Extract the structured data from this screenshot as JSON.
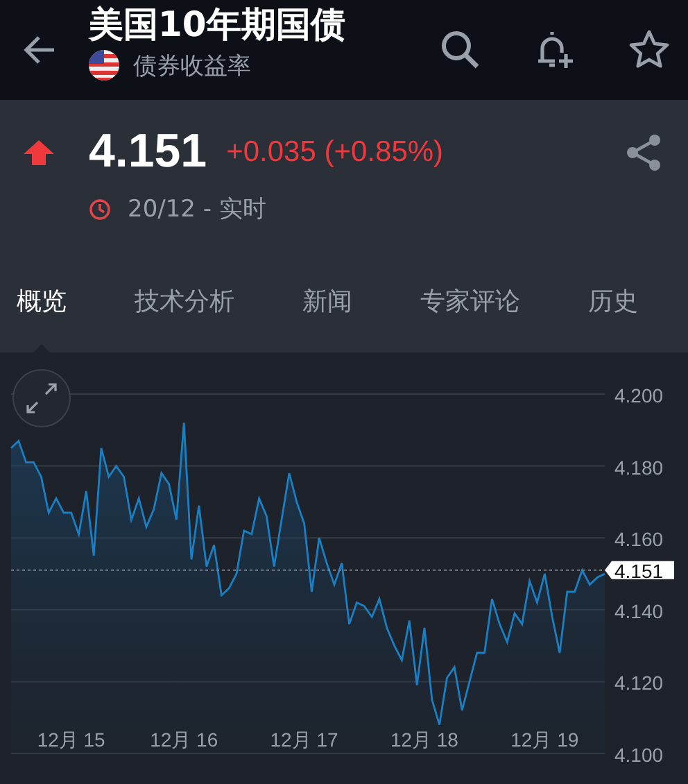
{
  "header": {
    "title": "美国10年期国债",
    "subtitle": "债券收益率"
  },
  "quote": {
    "rising": true,
    "price": "4.151",
    "change": "+0.035 (+0.85%)",
    "time": "20/12 - 实时"
  },
  "tabs": [
    {
      "label": "概览",
      "selected": true
    },
    {
      "label": "技术分析",
      "selected": false
    },
    {
      "label": "新闻",
      "selected": false
    },
    {
      "label": "专家评论",
      "selected": false
    },
    {
      "label": "历史",
      "selected": false
    }
  ],
  "chart": {
    "chart_data": {
      "type": "area",
      "categories": [
        null,
        null,
        null,
        null,
        null,
        null,
        null,
        null,
        "12月 15",
        null,
        null,
        null,
        null,
        null,
        null,
        null,
        null,
        null,
        null,
        null,
        null,
        null,
        null,
        "12月 16",
        null,
        null,
        null,
        null,
        null,
        null,
        null,
        null,
        null,
        null,
        null,
        null,
        null,
        null,
        null,
        "12月 17",
        null,
        null,
        null,
        null,
        null,
        null,
        null,
        null,
        null,
        null,
        null,
        null,
        null,
        null,
        null,
        "12月 18",
        null,
        null,
        null,
        null,
        null,
        null,
        null,
        null,
        null,
        null,
        null,
        null,
        null,
        null,
        null,
        "12月 19",
        null,
        null,
        null,
        null,
        null,
        null,
        null,
        null
      ],
      "series": [
        {
          "color": "#1b7fc4",
          "values": [
            4.185,
            4.187,
            4.181,
            4.181,
            4.177,
            4.167,
            4.171,
            4.167,
            4.167,
            4.161,
            4.173,
            4.155,
            4.185,
            4.177,
            4.18,
            4.177,
            4.165,
            4.171,
            4.163,
            4.168,
            4.178,
            4.175,
            4.165,
            4.192,
            4.154,
            4.169,
            4.152,
            4.158,
            4.144,
            4.146,
            4.15,
            4.162,
            4.161,
            4.171,
            4.166,
            4.152,
            4.165,
            4.178,
            4.17,
            4.164,
            4.145,
            4.16,
            4.153,
            4.147,
            4.153,
            4.136,
            4.142,
            4.141,
            4.138,
            4.143,
            4.135,
            4.13,
            4.126,
            4.137,
            4.119,
            4.135,
            4.115,
            4.108,
            4.121,
            4.124,
            4.112,
            4.12,
            4.128,
            4.128,
            4.143,
            4.136,
            4.131,
            4.139,
            4.136,
            4.148,
            4.142,
            4.15,
            4.138,
            4.128,
            4.145,
            4.145,
            4.151,
            4.147,
            4.149,
            4.15
          ]
        }
      ],
      "ylim": [
        4.1,
        4.2
      ],
      "yticks": [
        {
          "value": 4.1,
          "label": "4.100"
        },
        {
          "value": 4.12,
          "label": "4.120"
        },
        {
          "value": 4.14,
          "label": "4.140"
        },
        {
          "value": 4.16,
          "label": "4.160"
        },
        {
          "value": 4.18,
          "label": "4.180"
        },
        {
          "value": 4.2,
          "label": "4.200"
        }
      ],
      "grid": true,
      "ref_lines": [
        {
          "axis": "y",
          "value": 4.151,
          "label": "4.151"
        }
      ]
    }
  }
}
